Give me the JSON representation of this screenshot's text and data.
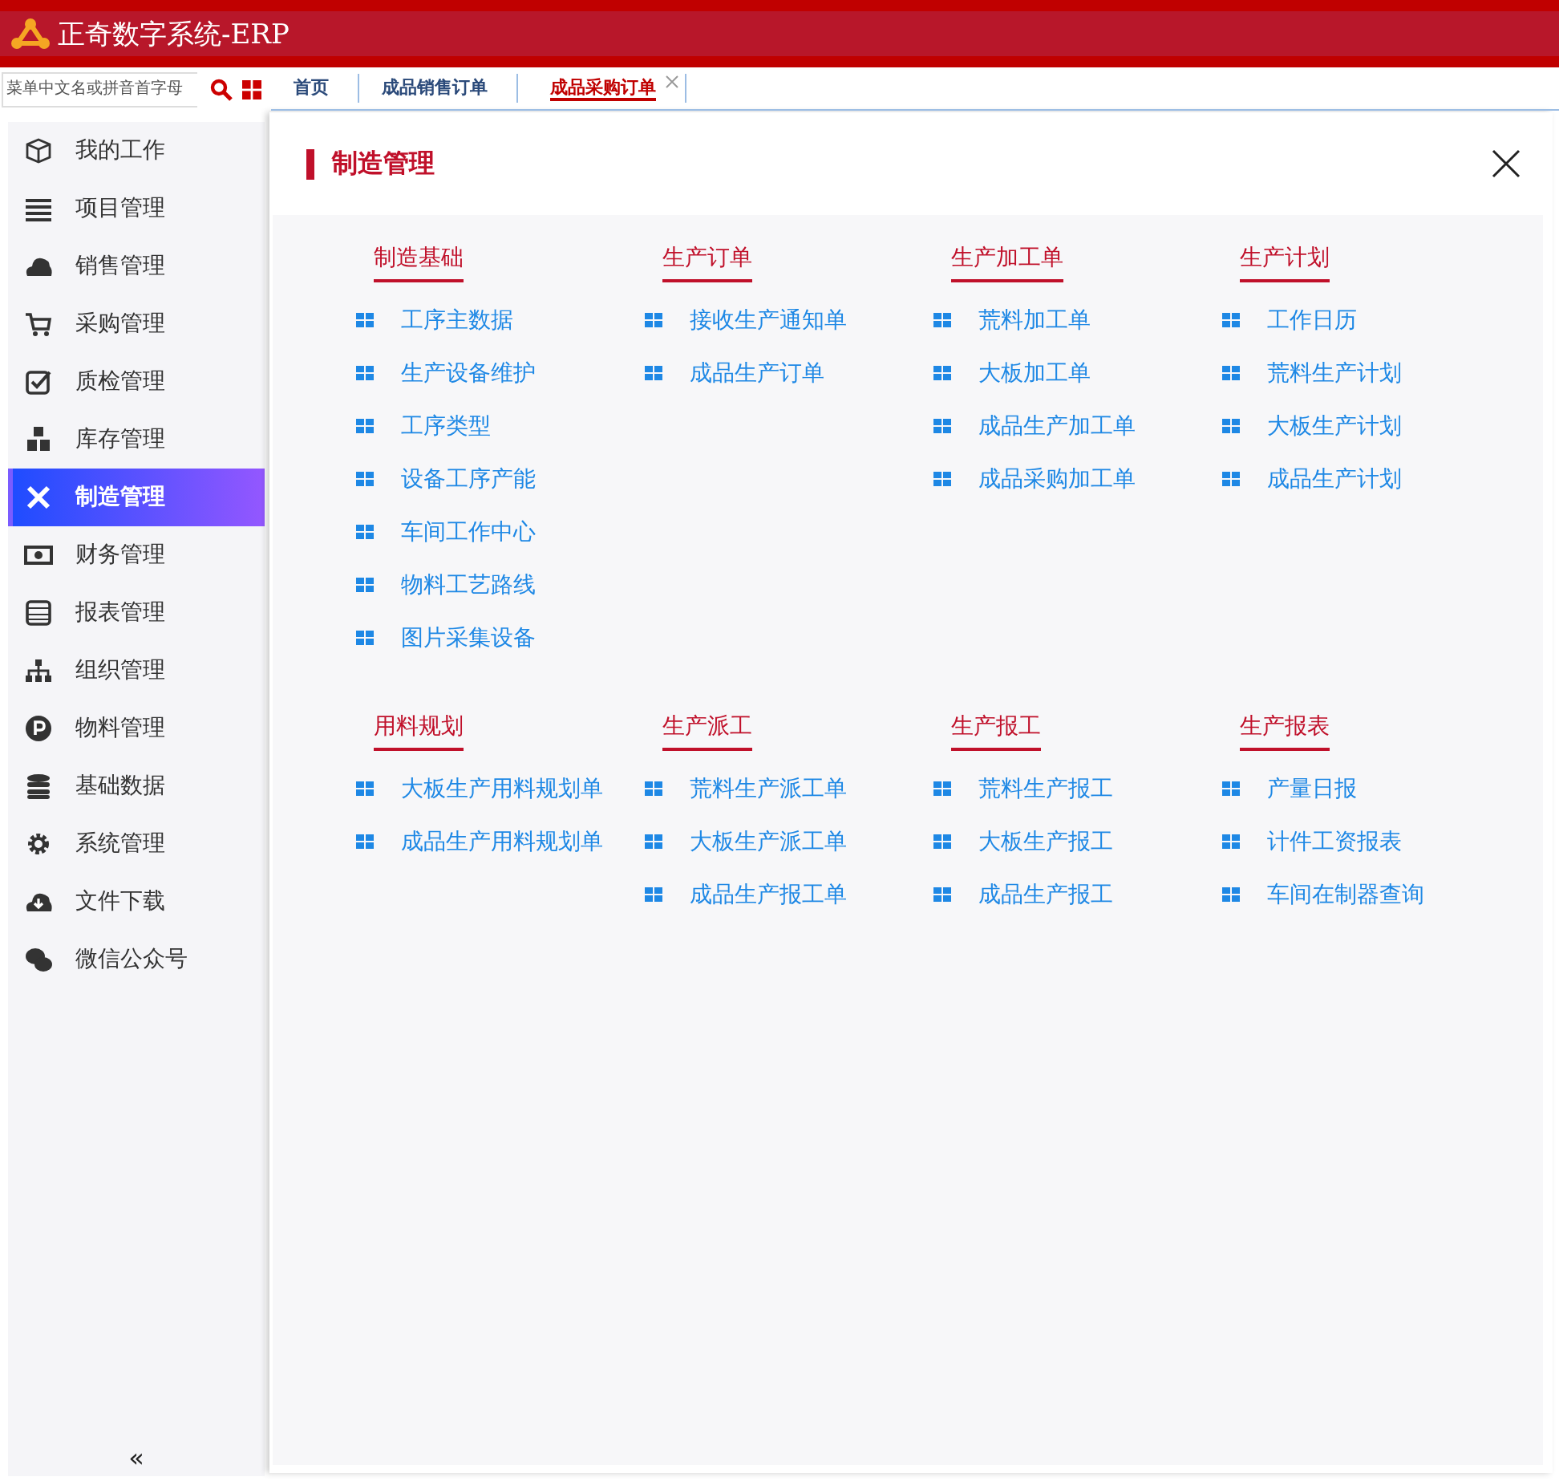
{
  "header": {
    "title": "正奇数字系统-ERP"
  },
  "search": {
    "placeholder": "菜单中文名或拼音首字母"
  },
  "tabs": [
    {
      "label": "首页",
      "selected": false,
      "closable": false
    },
    {
      "label": "成品销售订单",
      "selected": false,
      "closable": false
    },
    {
      "label": "成品采购订单",
      "selected": true,
      "closable": true
    }
  ],
  "sidebar": {
    "items": [
      {
        "label": "我的工作",
        "selected": false
      },
      {
        "label": "项目管理",
        "selected": false
      },
      {
        "label": "销售管理",
        "selected": false
      },
      {
        "label": "采购管理",
        "selected": false
      },
      {
        "label": "质检管理",
        "selected": false
      },
      {
        "label": "库存管理",
        "selected": false
      },
      {
        "label": "制造管理",
        "selected": true
      },
      {
        "label": "财务管理",
        "selected": false
      },
      {
        "label": "报表管理",
        "selected": false
      },
      {
        "label": "组织管理",
        "selected": false
      },
      {
        "label": "物料管理",
        "selected": false
      },
      {
        "label": "基础数据",
        "selected": false
      },
      {
        "label": "系统管理",
        "selected": false
      },
      {
        "label": "文件下载",
        "selected": false
      },
      {
        "label": "微信公众号",
        "selected": false
      }
    ],
    "collapse": "«"
  },
  "panel": {
    "title": "制造管理",
    "groups": [
      {
        "title": "制造基础",
        "items": [
          "工序主数据",
          "生产设备维护",
          "工序类型",
          "设备工序产能",
          "车间工作中心",
          "物料工艺路线",
          "图片采集设备"
        ]
      },
      {
        "title": "生产订单",
        "items": [
          "接收生产通知单",
          "成品生产订单"
        ]
      },
      {
        "title": "生产加工单",
        "items": [
          "荒料加工单",
          "大板加工单",
          "成品生产加工单",
          "成品采购加工单"
        ]
      },
      {
        "title": "生产计划",
        "items": [
          "工作日历",
          "荒料生产计划",
          "大板生产计划",
          "成品生产计划"
        ]
      },
      {
        "title": "用料规划",
        "items": [
          "大板生产用料规划单",
          "成品生产用料规划单"
        ]
      },
      {
        "title": "生产派工",
        "items": [
          "荒料生产派工单",
          "大板生产派工单",
          "成品生产报工单"
        ]
      },
      {
        "title": "生产报工",
        "items": [
          "荒料生产报工",
          "大板生产报工",
          "成品生产报工"
        ]
      },
      {
        "title": "生产报表",
        "items": [
          "产量日报",
          "计件工资报表",
          "车间在制器查询"
        ]
      }
    ]
  }
}
